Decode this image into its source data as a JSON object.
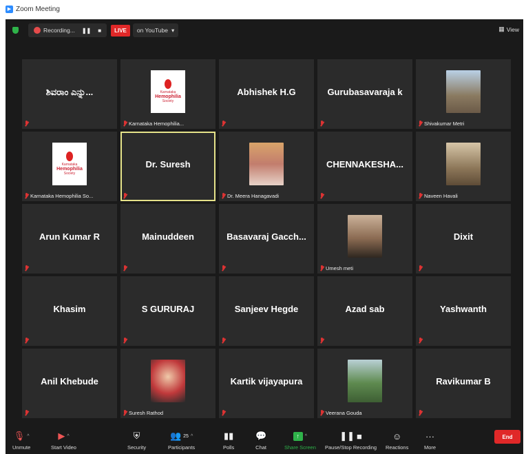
{
  "titlebar": {
    "title": "Zoom Meeting"
  },
  "topbar": {
    "recording_label": "Recording...",
    "pause_icon": "❚❚",
    "stop_icon": "■",
    "live_label": "LIVE",
    "stream_label": "on YouTube",
    "stream_caret": "▾",
    "view_label": "View",
    "view_icon": "▦"
  },
  "participants": [
    {
      "display": "ಶಿವರಾಂ ಎನ್ನು...",
      "label": ""
    },
    {
      "display": "",
      "label": "Karnataka Hemophilia...",
      "thumb": "logo"
    },
    {
      "display": "Abhishek H.G",
      "label": ""
    },
    {
      "display": "Gurubasavaraja k",
      "label": ""
    },
    {
      "display": "",
      "label": "Shivakumar Metri",
      "thumb": "p1"
    },
    {
      "display": "",
      "label": "Karnataka Hemophilia So...",
      "thumb": "logo"
    },
    {
      "display": "Dr. Suresh",
      "label": "",
      "active": true
    },
    {
      "display": "",
      "label": "Dr. Meera Hanagavadi",
      "thumb": "p2"
    },
    {
      "display": "CHENNAKESHA...",
      "label": ""
    },
    {
      "display": "",
      "label": "Naveen Havali",
      "thumb": "p3"
    },
    {
      "display": "Arun Kumar R",
      "label": ""
    },
    {
      "display": "Mainuddeen",
      "label": ""
    },
    {
      "display": "Basavaraj  Gacch...",
      "label": ""
    },
    {
      "display": "",
      "label": "Umesh meti",
      "thumb": "p4"
    },
    {
      "display": "Dixit",
      "label": ""
    },
    {
      "display": "Khasim",
      "label": ""
    },
    {
      "display": "S GURURAJ",
      "label": ""
    },
    {
      "display": "Sanjeev Hegde",
      "label": ""
    },
    {
      "display": "Azad sab",
      "label": ""
    },
    {
      "display": "Yashwanth",
      "label": ""
    },
    {
      "display": "Anil Khebude",
      "label": ""
    },
    {
      "display": "",
      "label": "Suresh Rathod",
      "thumb": "p5"
    },
    {
      "display": "Kartik vijayapura",
      "label": ""
    },
    {
      "display": "",
      "label": "Veerana Gouda",
      "thumb": "p6"
    },
    {
      "display": "Ravikumar B",
      "label": ""
    }
  ],
  "logo_text": {
    "top": "Karnataka",
    "main": "Hemophilia",
    "sub": "Society"
  },
  "toolbar": {
    "unmute": "Unmute",
    "start_video": "Start Video",
    "security": "Security",
    "participants": "Participants",
    "participants_count": "25",
    "polls": "Polls",
    "chat": "Chat",
    "share_screen": "Share Screen",
    "pause_stop_recording": "Pause/Stop Recording",
    "reactions": "Reactions",
    "more": "More",
    "end": "End"
  },
  "colors": {
    "accent_live": "#e02828",
    "share_green": "#2fb34a",
    "active_speaker": "#e6e38a",
    "muted_mic": "#d33333"
  }
}
